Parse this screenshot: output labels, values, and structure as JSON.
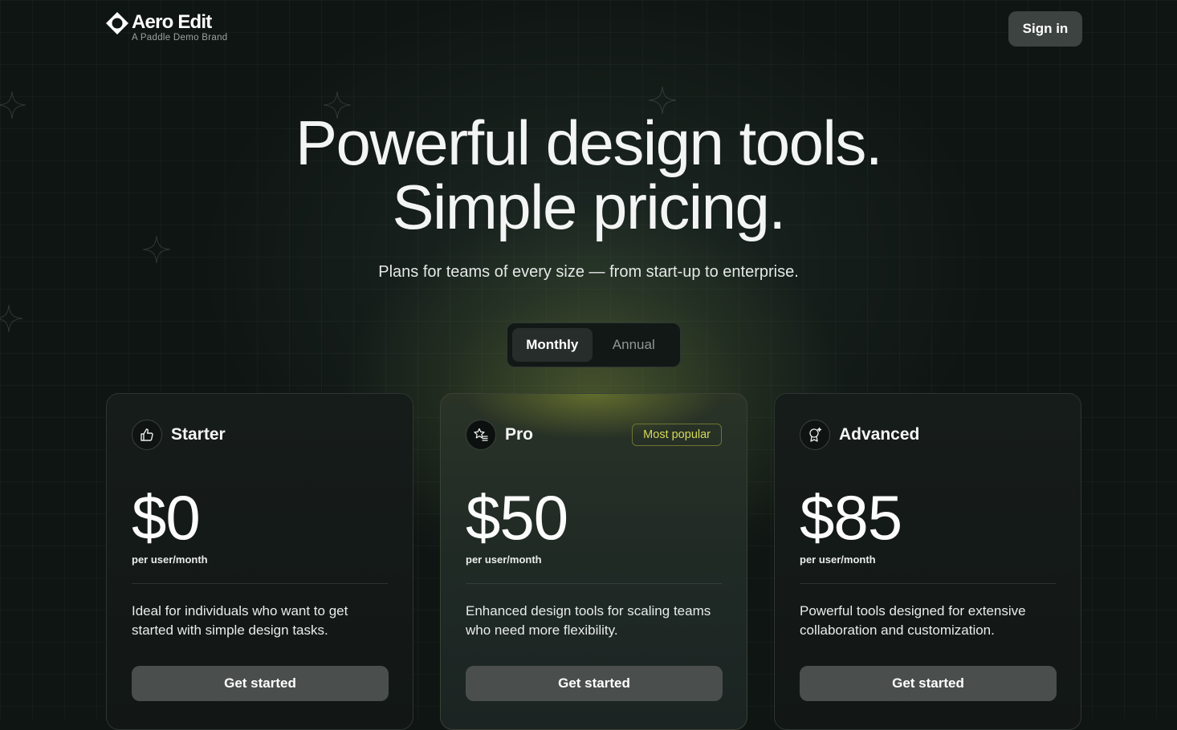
{
  "brand": {
    "name": "Aero Edit",
    "subtitle": "A Paddle Demo Brand",
    "logo_icon": "diamond-ring-icon"
  },
  "header": {
    "signin_label": "Sign in"
  },
  "hero": {
    "title_line1": "Powerful design tools.",
    "title_line2": "Simple pricing.",
    "subtitle": "Plans for teams of every size — from start-up to enterprise."
  },
  "billing_toggle": {
    "options": [
      "Monthly",
      "Annual"
    ],
    "selected": "Monthly"
  },
  "plans": [
    {
      "name": "Starter",
      "icon": "thumbs-up-icon",
      "price": "$0",
      "period": "per user/month",
      "description": "Ideal for individuals who want to get started with simple design tasks.",
      "cta": "Get started",
      "badge": ""
    },
    {
      "name": "Pro",
      "icon": "star-list-icon",
      "price": "$50",
      "period": "per user/month",
      "description": "Enhanced design tools for scaling teams who need more flexibility.",
      "cta": "Get started",
      "badge": "Most popular"
    },
    {
      "name": "Advanced",
      "icon": "award-sparkle-icon",
      "price": "$85",
      "period": "per user/month",
      "description": "Powerful tools designed for extensive collaboration and customization.",
      "cta": "Get started",
      "badge": ""
    }
  ],
  "colors": {
    "background": "#0f1513",
    "accent": "#d4d95a",
    "button": "#4a4f4d"
  }
}
